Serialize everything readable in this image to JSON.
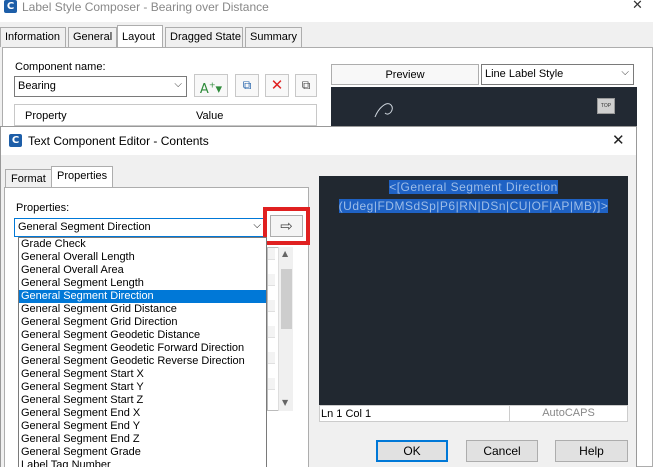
{
  "background_window": {
    "title": "Label Style Composer - Bearing over Distance",
    "tabs": [
      "Information",
      "General",
      "Layout",
      "Dragged State",
      "Summary"
    ],
    "active_tab": "Layout",
    "component_name_label": "Component name:",
    "component_name_value": "Bearing",
    "grid_headers": [
      "Property",
      "Value"
    ],
    "preview_tab": "Preview",
    "preview_combo": "Line Label Style",
    "top_button": "TOP"
  },
  "dialog": {
    "title": "Text Component Editor - Contents",
    "tabs": [
      "Format",
      "Properties"
    ],
    "active_tab": "Properties",
    "properties_label": "Properties:",
    "properties_selected": "General Segment Direction",
    "dropdown_items": [
      "Grade Check",
      "General Overall Length",
      "General Overall Area",
      "General Segment Length",
      "General Segment Direction",
      "General Segment Grid Distance",
      "General Segment Grid Direction",
      "General Segment Geodetic Distance",
      "General Segment Geodetic Forward Direction",
      "General Segment Geodetic Reverse Direction",
      "General Segment Start X",
      "General Segment Start Y",
      "General Segment Start Z",
      "General Segment End X",
      "General Segment End Y",
      "General Segment End Z",
      "General Segment Grade",
      "Label Tag Number"
    ],
    "dropdown_selected_index": 4,
    "editor_line1": "<[General Segment Direction",
    "editor_line2": "(Udeg|FDMSdSp|P6|RN|DSn|CU|OF|AP|MB)]>",
    "status_position": "Ln 1 Col 1",
    "status_caps": "AutoCAPS",
    "buttons": {
      "ok": "OK",
      "cancel": "Cancel",
      "help": "Help"
    },
    "colors": {
      "selection": "#0078d7",
      "editor_bg": "#212830",
      "highlight": "#1f62c4",
      "callout": "#e02020"
    }
  }
}
